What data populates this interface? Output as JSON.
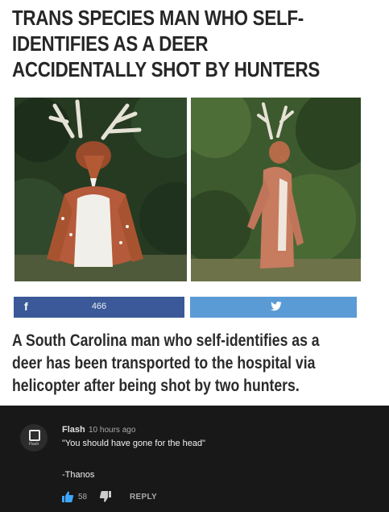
{
  "article": {
    "headline_lines": [
      "TRANS SPECIES MAN WHO SELF-",
      "IDENTIFIES AS A DEER",
      "ACCIDENTALLY SHOT BY HUNTERS"
    ],
    "share": {
      "facebook_icon": "facebook-icon",
      "facebook_count": "466",
      "twitter_icon": "twitter-bird-icon",
      "facebook_color": "#3b5998",
      "twitter_color": "#5b9bd5"
    },
    "lede_lines": [
      "A South Carolina man who self-identifies as a",
      "deer has been transported to the hospital via",
      "helicopter after being shot by two hunters."
    ]
  },
  "comment": {
    "avatar_text": "Flash",
    "author": "Flash",
    "time": "10 hours ago",
    "text_line1": "\"You should have gone for the head\"",
    "text_line2": "-Thanos",
    "likes": "58",
    "like_icon": "thumbs-up-icon",
    "dislike_icon": "thumbs-down-icon",
    "reply_label": "REPLY",
    "like_color": "#3ea6ff"
  }
}
